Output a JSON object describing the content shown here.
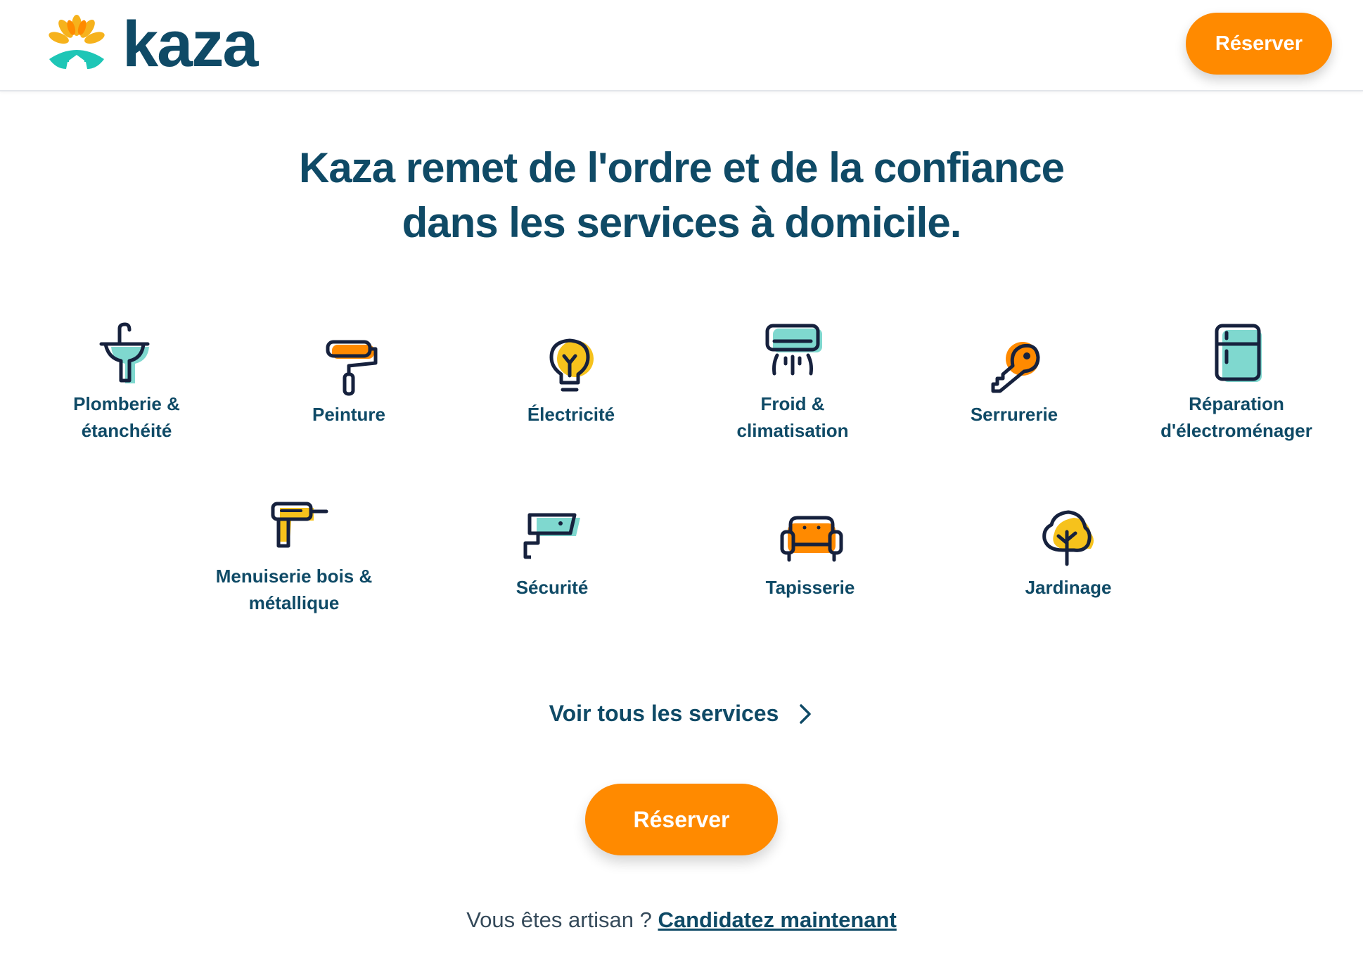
{
  "brand": {
    "name": "kaza",
    "colors": {
      "primary": "#0f4a66",
      "accent": "#ff8a00",
      "teal": "#1ec6b6",
      "yellow": "#f6c21c"
    }
  },
  "header": {
    "cta_label": "Réserver"
  },
  "headline": {
    "part1": "Kaza remet de ",
    "highlight1": "l'ordre",
    "part2": " et de la ",
    "highlight2": "confiance",
    "line2": "dans les services à domicile."
  },
  "services": [
    {
      "label_line1": "Plomberie &",
      "label_line2": "étanchéité",
      "icon": "sink-icon"
    },
    {
      "label_line1": "Peinture",
      "label_line2": "",
      "icon": "paint-roller-icon"
    },
    {
      "label_line1": "Électricité",
      "label_line2": "",
      "icon": "light-bulb-icon"
    },
    {
      "label_line1": "Froid &",
      "label_line2": "climatisation",
      "icon": "air-conditioner-icon"
    },
    {
      "label_line1": "Serrurerie",
      "label_line2": "",
      "icon": "key-icon"
    },
    {
      "label_line1": "Réparation",
      "label_line2": "d'électroménager",
      "icon": "fridge-icon"
    },
    {
      "label_line1": "Menuiserie bois &",
      "label_line2": "métallique",
      "icon": "drill-icon"
    },
    {
      "label_line1": "Sécurité",
      "label_line2": "",
      "icon": "security-camera-icon"
    },
    {
      "label_line1": "Tapisserie",
      "label_line2": "",
      "icon": "sofa-icon"
    },
    {
      "label_line1": "Jardinage",
      "label_line2": "",
      "icon": "tree-icon"
    }
  ],
  "see_all": {
    "label": "Voir tous les services",
    "icon": "chevron-right-icon"
  },
  "main_cta": {
    "label": "Réserver"
  },
  "footer": {
    "question": "Vous êtes artisan ? ",
    "link_label": "Candidatez maintenant"
  }
}
